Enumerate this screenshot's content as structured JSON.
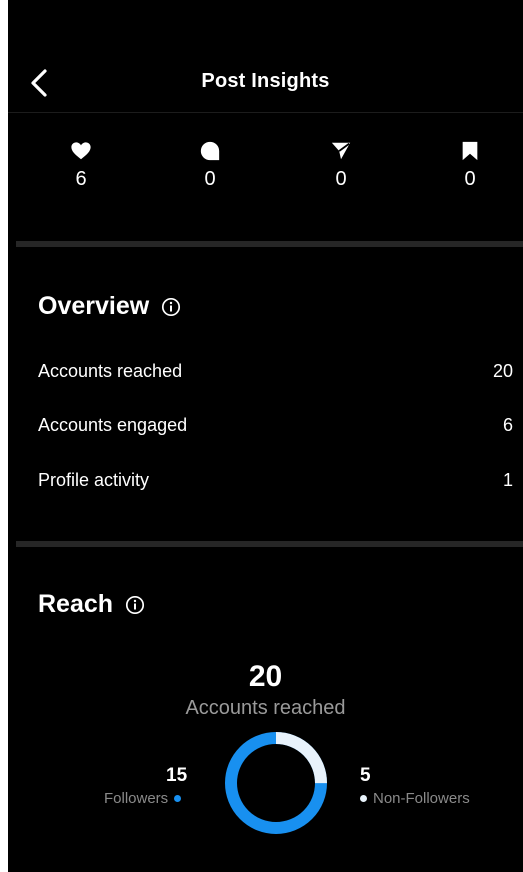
{
  "header": {
    "title": "Post Insights"
  },
  "stats": [
    {
      "icon": "heart-icon",
      "value": "6"
    },
    {
      "icon": "comment-icon",
      "value": "0"
    },
    {
      "icon": "share-icon",
      "value": "0"
    },
    {
      "icon": "bookmark-icon",
      "value": "0"
    }
  ],
  "overview": {
    "title": "Overview",
    "rows": [
      {
        "label": "Accounts reached",
        "value": "20"
      },
      {
        "label": "Accounts engaged",
        "value": "6"
      },
      {
        "label": "Profile activity",
        "value": "1"
      }
    ]
  },
  "reach": {
    "title": "Reach",
    "total": "20",
    "total_label": "Accounts reached",
    "followers_value": "15",
    "followers_label": "Followers",
    "non_followers_value": "5",
    "non_followers_label": "Non-Followers",
    "followers_count": 15,
    "non_followers_count": 5
  },
  "colors": {
    "background": "#000000",
    "accent": "#1890f0",
    "secondary": "#e8f2fb",
    "divider": "#262626",
    "muted_text": "#9a9a9a"
  }
}
